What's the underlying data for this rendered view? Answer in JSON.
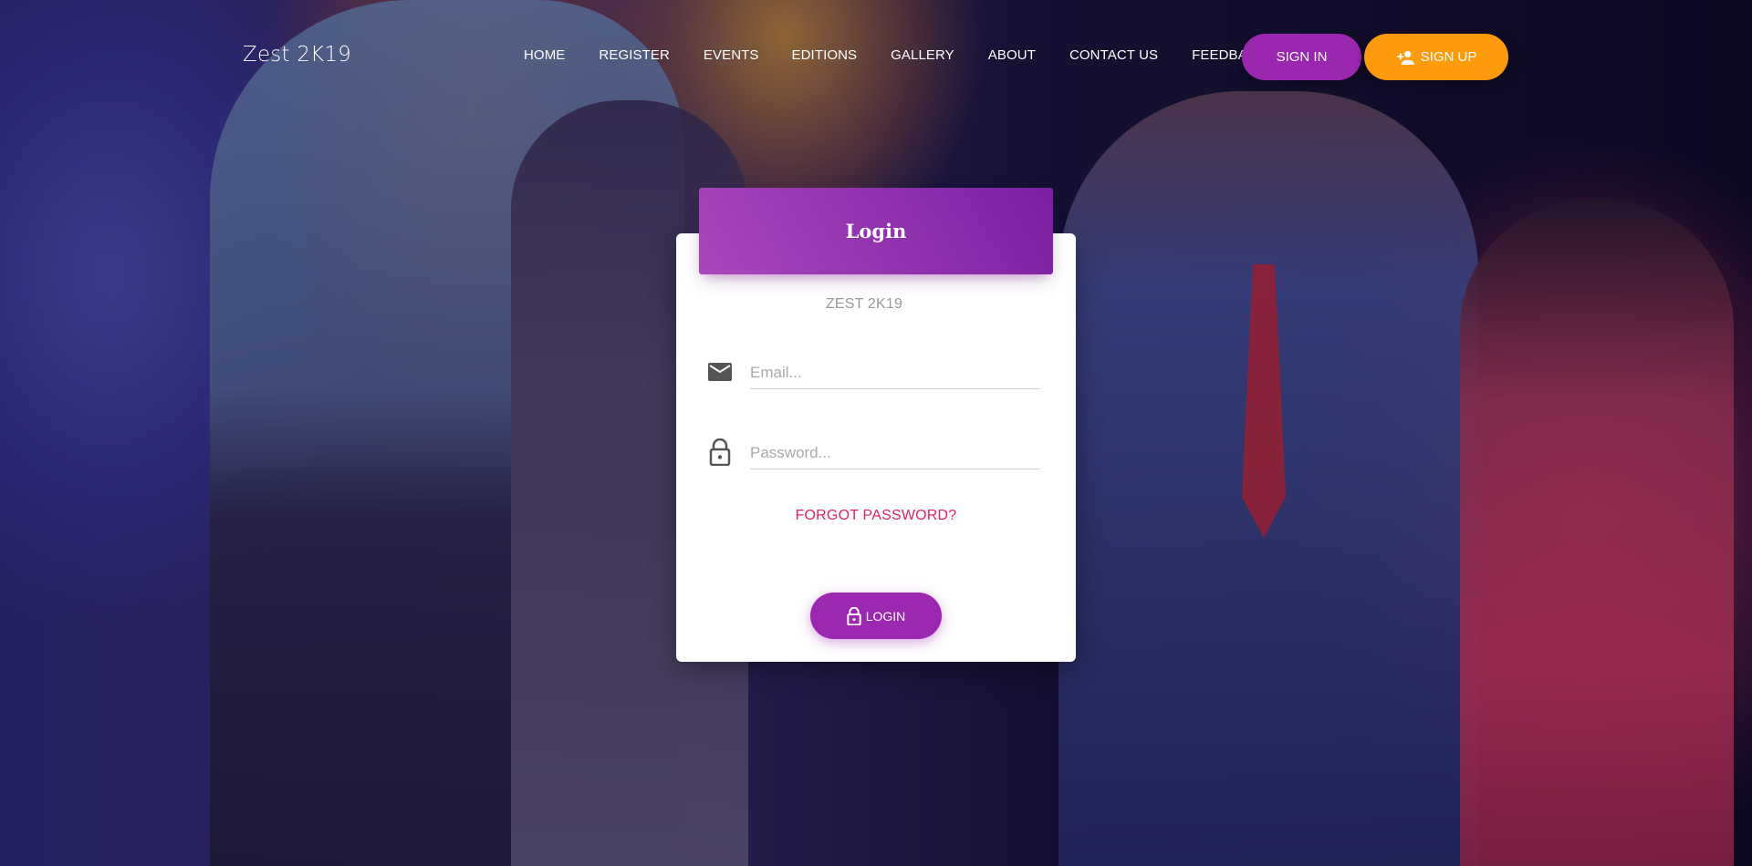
{
  "brand": "Zest 2K19",
  "nav": {
    "links": [
      "HOME",
      "REGISTER",
      "EVENTS",
      "EDITIONS",
      "GALLERY",
      "ABOUT",
      "CONTACT US",
      "FEEDBACK"
    ],
    "sign_in_label": "SIGN IN",
    "sign_up_label": "SIGN UP",
    "sign_up_icon": "person-add-icon"
  },
  "login_card": {
    "title": "Login",
    "subtitle": "ZEST 2K19",
    "email_placeholder": "Email...",
    "email_value": "",
    "email_icon": "email-icon",
    "password_placeholder": "Password...",
    "password_value": "",
    "password_icon": "lock-icon",
    "forgot_label": "FORGOT PASSWORD?",
    "login_button_label": "LOGIN",
    "login_button_icon": "lock-icon"
  },
  "colors": {
    "primary": "#9c27b0",
    "warning": "#fd9b0d",
    "link": "#e91e63"
  }
}
